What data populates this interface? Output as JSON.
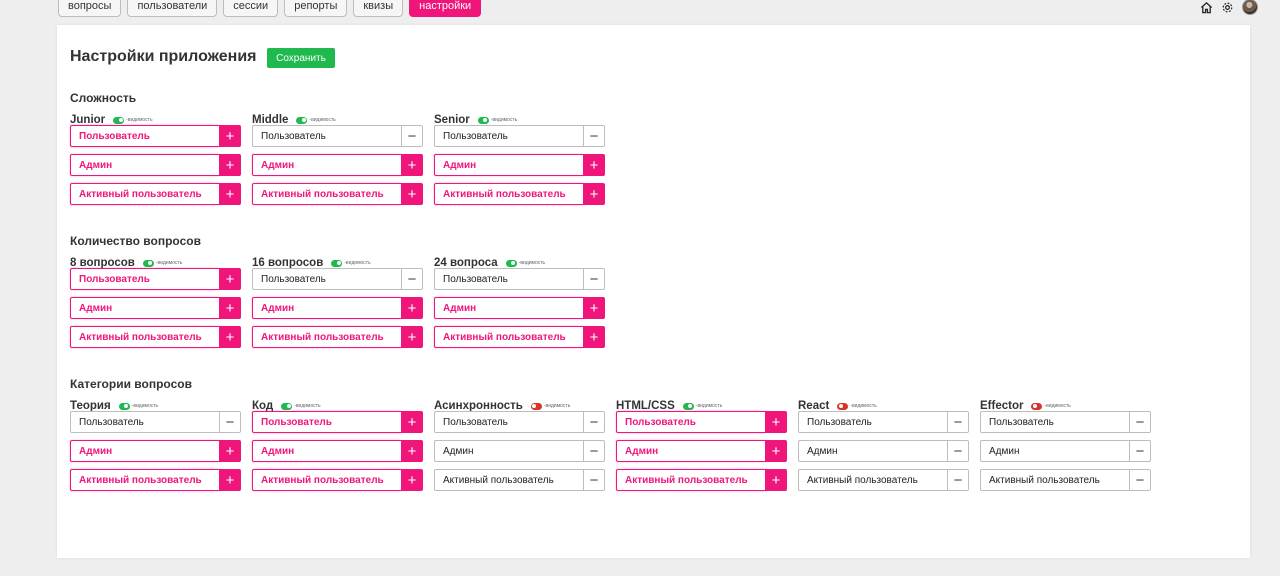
{
  "nav": {
    "tabs": [
      {
        "label": "вопросы",
        "active": false
      },
      {
        "label": "пользователи",
        "active": false
      },
      {
        "label": "сессии",
        "active": false
      },
      {
        "label": "репорты",
        "active": false
      },
      {
        "label": "квизы",
        "active": false
      },
      {
        "label": "настройки",
        "active": true
      }
    ],
    "icons": [
      "home-icon",
      "gear-icon",
      "avatar"
    ]
  },
  "page": {
    "title": "Настройки приложения",
    "save_label": "Сохранить"
  },
  "colors": {
    "accent": "#f0157a",
    "save": "#1fb94e",
    "toggle_on": "#1fb94e",
    "toggle_off": "#d9342b"
  },
  "visibility_label": "-видимость",
  "sections": [
    {
      "title": "Сложность",
      "groups": [
        {
          "name": "Junior",
          "visible": true,
          "rows": [
            {
              "label": "Пользователь",
              "selected": true
            },
            {
              "label": "Админ",
              "selected": true
            },
            {
              "label": "Активный пользователь",
              "selected": true
            }
          ]
        },
        {
          "name": "Middle",
          "visible": true,
          "rows": [
            {
              "label": "Пользователь",
              "selected": false
            },
            {
              "label": "Админ",
              "selected": true
            },
            {
              "label": "Активный пользователь",
              "selected": true
            }
          ]
        },
        {
          "name": "Senior",
          "visible": true,
          "rows": [
            {
              "label": "Пользователь",
              "selected": false
            },
            {
              "label": "Админ",
              "selected": true
            },
            {
              "label": "Активный пользователь",
              "selected": true
            }
          ]
        }
      ]
    },
    {
      "title": "Количество вопросов",
      "groups": [
        {
          "name": "8 вопросов",
          "visible": true,
          "rows": [
            {
              "label": "Пользователь",
              "selected": true
            },
            {
              "label": "Админ",
              "selected": true
            },
            {
              "label": "Активный пользователь",
              "selected": true
            }
          ]
        },
        {
          "name": "16 вопросов",
          "visible": true,
          "rows": [
            {
              "label": "Пользователь",
              "selected": false
            },
            {
              "label": "Админ",
              "selected": true
            },
            {
              "label": "Активный пользователь",
              "selected": true
            }
          ]
        },
        {
          "name": "24 вопроса",
          "visible": true,
          "rows": [
            {
              "label": "Пользователь",
              "selected": false
            },
            {
              "label": "Админ",
              "selected": true
            },
            {
              "label": "Активный пользователь",
              "selected": true
            }
          ]
        }
      ]
    },
    {
      "title": "Категории вопросов",
      "groups": [
        {
          "name": "Теория",
          "visible": true,
          "rows": [
            {
              "label": "Пользователь",
              "selected": false
            },
            {
              "label": "Админ",
              "selected": true
            },
            {
              "label": "Активный пользователь",
              "selected": true
            }
          ]
        },
        {
          "name": "Код",
          "visible": true,
          "rows": [
            {
              "label": "Пользователь",
              "selected": true
            },
            {
              "label": "Админ",
              "selected": true
            },
            {
              "label": "Активный пользователь",
              "selected": true
            }
          ]
        },
        {
          "name": "Асинхронность",
          "visible": false,
          "rows": [
            {
              "label": "Пользователь",
              "selected": false
            },
            {
              "label": "Админ",
              "selected": false
            },
            {
              "label": "Активный пользователь",
              "selected": false
            }
          ]
        },
        {
          "name": "HTML/CSS",
          "visible": true,
          "rows": [
            {
              "label": "Пользователь",
              "selected": true
            },
            {
              "label": "Админ",
              "selected": true
            },
            {
              "label": "Активный пользователь",
              "selected": true
            }
          ]
        },
        {
          "name": "React",
          "visible": false,
          "rows": [
            {
              "label": "Пользователь",
              "selected": false
            },
            {
              "label": "Админ",
              "selected": false
            },
            {
              "label": "Активный пользователь",
              "selected": false
            }
          ]
        },
        {
          "name": "Effector",
          "visible": false,
          "rows": [
            {
              "label": "Пользователь",
              "selected": false
            },
            {
              "label": "Админ",
              "selected": false
            },
            {
              "label": "Активный пользователь",
              "selected": false
            }
          ]
        }
      ]
    }
  ]
}
